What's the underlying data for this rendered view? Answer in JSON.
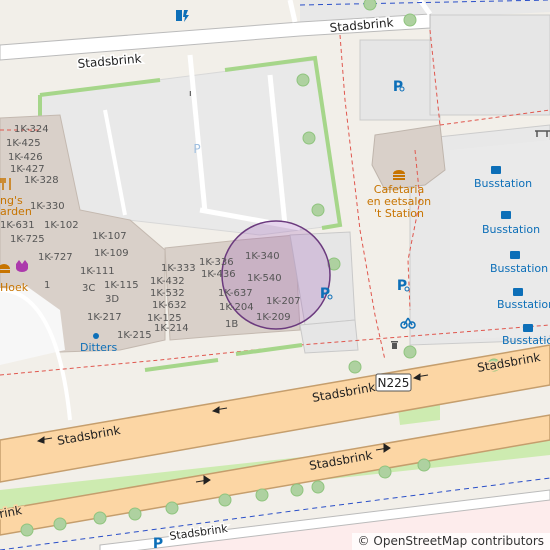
{
  "map": {
    "roads": {
      "stadsbrink_north": "Stadsbrink",
      "stadsbrink_north_east": "Stadsbrink",
      "stadsbrink_main_west": "Stadsbrink",
      "stadsbrink_main_east": "Stadsbrink",
      "stadsbrink_main_east2": "Stadsbrink",
      "stadsbrink_lower": "Stadsbrink",
      "stadsbrink_lower_west": "rink",
      "stadsbrink_bottom": "Stadsbrink",
      "route_ref": "N225"
    },
    "places": {
      "cafetaria_name": "Cafetaria en eetsalon 't Station",
      "cafetaria_line1": "Cafetaria",
      "cafetaria_line2": "en eetsalon",
      "cafetaria_line3": "'t Station",
      "restaurant_partial": "ng's",
      "restaurant_partial2": "arden",
      "hoek_partial": "Hoek",
      "ditters": "Ditters",
      "busstation": "Busstation"
    },
    "house_numbers": {
      "n1k324": "1K-324",
      "n1k425": "1K-425",
      "n1k426": "1K-426",
      "n1k427": "1K-427",
      "n1k328": "1K-328",
      "n1k330": "1K-330",
      "n1k631": "1K-631",
      "n1k102": "1K-102",
      "n1k725": "1K-725",
      "n1k107": "1K-107",
      "n1k109": "1K-109",
      "n1k727": "1K-727",
      "n1": "1",
      "n1k111": "1K-111",
      "n3c": "3C",
      "n1k115": "1K-115",
      "n3d": "3D",
      "n1k217": "1K-217",
      "n1k215": "1K-215",
      "n1k333": "1K-333",
      "n1k432": "1K-432",
      "n1k532": "1K-532",
      "n1k632": "1K-632",
      "n1k125": "1K-125",
      "n1k214": "1K-214",
      "n1k336": "1K-336",
      "n1k436": "1K-436",
      "n1k637": "1K-637",
      "n1k204": "1K-204",
      "n1b": "1B",
      "n1k340": "1K-340",
      "n1k540": "1K-540",
      "n1k207": "1K-207",
      "n1k209": "1K-209"
    },
    "icons": {
      "parking": "parking-icon",
      "bicycle_parking": "bicycle-parking-icon",
      "bus_stop": "bus-stop-icon",
      "fast_food": "fast-food-icon",
      "restaurant": "restaurant-icon",
      "charging_station": "charging-station-icon",
      "waste_basket": "waste-basket-icon",
      "bicycle_rental": "bicycle-rental-icon",
      "shop": "shop-icon"
    },
    "colors": {
      "background": "#f2efe9",
      "building": "#d9d0c9",
      "parking_area": "#eeeeee",
      "primary_road": "#fcd6a4",
      "primary_casing": "#c59e6d",
      "grass": "#cdebb0",
      "tree": "#aed1a0",
      "highlight": "#9b59b6",
      "label_blue": "#0d6fb8",
      "cafe_orange": "#c77400",
      "dashed_red": "#e0574e",
      "rail_blue": "#2a4fc8",
      "retail_pink": "#fdecec"
    }
  },
  "attribution": {
    "symbol": "©",
    "text": "OpenStreetMap contributors"
  }
}
